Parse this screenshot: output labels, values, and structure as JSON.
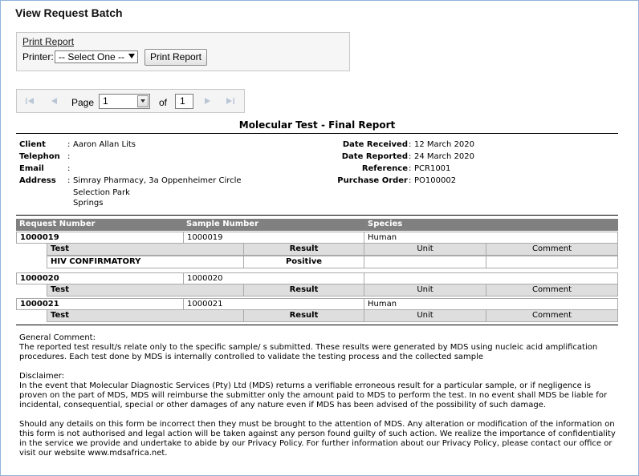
{
  "page": {
    "title": "View Request Batch"
  },
  "print_section": {
    "link_label": "Print Report",
    "printer_label": "Printer:",
    "printer_selected": "-- Select One --",
    "print_button": "Print Report"
  },
  "pager": {
    "page_label": "Page",
    "current_page": "1",
    "of_label": "of",
    "total_pages": "1",
    "icons": [
      "first-page-icon",
      "prev-page-icon",
      "next-page-icon",
      "last-page-icon"
    ]
  },
  "report": {
    "title": "Molecular Test - Final Report",
    "client_info": {
      "client_label": "Client",
      "client_value": "Aaron Allan Lits",
      "telephon_label": "Telephon",
      "telephon_value": "",
      "email_label": "Email",
      "email_value": "",
      "address_label": "Address",
      "address_lines": [
        "Simray Pharmacy, 3a Oppenheimer Circle",
        "Selection Park",
        "Springs"
      ]
    },
    "dates": {
      "received_label": "Date Received",
      "received_value": "12 March 2020",
      "reported_label": "Date Reported",
      "reported_value": "24 March 2020",
      "reference_label": "Reference",
      "reference_value": "PCR1001",
      "po_label": "Purchase Order",
      "po_value": "PO100002"
    },
    "table": {
      "headers": [
        "Request Number",
        "Sample Number",
        "Species"
      ],
      "sub_headers": [
        "Test",
        "Result",
        "Unit",
        "Comment"
      ],
      "requests": [
        {
          "request_number": "1000019",
          "sample_number": "1000019",
          "species": "Human",
          "tests": [
            {
              "test": "HIV CONFIRMATORY",
              "result": "Positive",
              "unit": "",
              "comment": ""
            }
          ]
        },
        {
          "request_number": "1000020",
          "sample_number": "1000020",
          "species": "",
          "tests": []
        },
        {
          "request_number": "1000021",
          "sample_number": "1000021",
          "species": "Human",
          "tests": []
        }
      ]
    },
    "general_comment": {
      "heading": "General Comment:",
      "text": "The reported test result/s relate only to the specific sample/ s submitted. These results were generated by MDS using nucleic acid amplification procedures. Each test done by MDS is internally controlled to validate the testing process and the collected sample"
    },
    "disclaimer": {
      "heading": "Disclaimer:",
      "text": "In the event that Molecular Diagnostic Services (Pty) Ltd (MDS) returns a verifiable erroneous result for a particular sample, or if negligence is proven on the part of MDS, MDS will reimburse the submitter only the amount paid to MDS to perform the test. In no event shall MDS be liable for incidental, consequential, special or other damages of any nature even if MDS has been advised of the possibility of such damage."
    },
    "footer_note": "Should any details on this form be incorrect then they must be brought to the attention of MDS. Any alteration or modification of the information on this form is not authorised and legal action will be taken against any person found guilty of such action. We realize the importance of confidentiality in the service we provide and undertake to abide by our Privacy Policy. For further information about our Privacy Policy, please contact our office or visit our website www.mdsafrica.net."
  }
}
